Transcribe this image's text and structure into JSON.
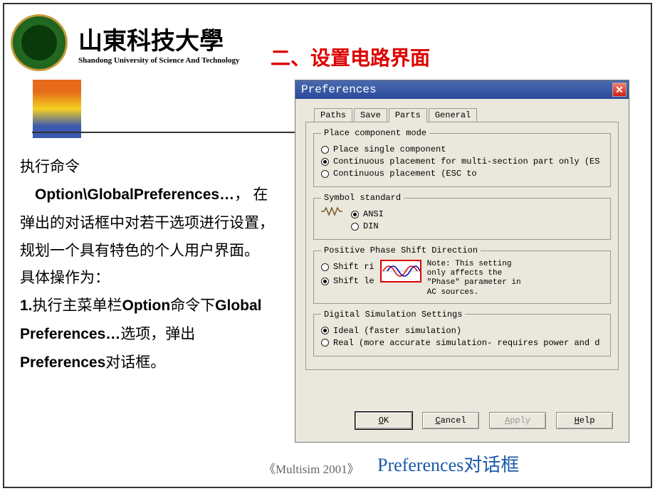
{
  "header": {
    "uni_cn": "山東科技大學",
    "uni_en": "Shandong University of Science And Technology",
    "title": "二、设置电路界面"
  },
  "text": {
    "l1": "执行命令",
    "l2a": "Option\\GlobalPreferences…",
    "l2b": "，",
    "l3": "在弹出的对话框中对若干选项进行设置，规划一个具有特色的个人用户界面。",
    "l4": "具体操作为：",
    "l5a": " 1.",
    "l5b": "执行主菜单栏",
    "l5c": "Option",
    "l5d": "命令下",
    "l5e": "Global  Preferences…",
    "l5f": "选项，弹出",
    "l5g": "Preferences",
    "l5h": "对话框。"
  },
  "footnote": "《Multisim 2001》",
  "caption": "Preferences对话框",
  "dialog": {
    "title": "Preferences",
    "tabs": {
      "paths": "Paths",
      "save": "Save",
      "parts": "Parts",
      "general": "General"
    },
    "grp_place": {
      "legend": "Place component mode",
      "opt1": "Place single component",
      "opt2": "Continuous placement for multi-section part only (ES",
      "opt3": "Continuous placement (ESC to"
    },
    "grp_sym": {
      "legend": "Symbol standard",
      "ansi": "ANSI",
      "din": "DIN"
    },
    "grp_phase": {
      "legend": "Positive Phase Shift Direction",
      "opt1": "Shift ri",
      "opt2": "Shift le",
      "note": "Note: This setting only affects the \"Phase\" parameter in AC sources."
    },
    "grp_dig": {
      "legend": "Digital Simulation Settings",
      "opt1": "Ideal (faster simulation)",
      "opt2": "Real (more accurate simulation- requires power and d"
    },
    "btns": {
      "ok": "OK",
      "cancel": "Cancel",
      "apply": "Apply",
      "help": "Help"
    }
  }
}
